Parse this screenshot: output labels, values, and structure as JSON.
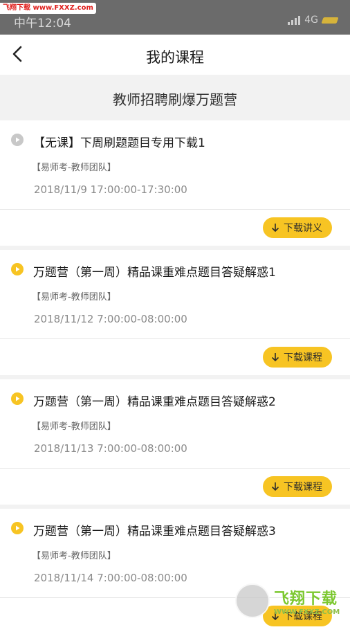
{
  "status_bar": {
    "watermark_badge": "飞翔下载 www.FXXZ.com",
    "time": "中午12:04",
    "network": "4G"
  },
  "nav": {
    "back_icon": "chevron-left-icon",
    "title": "我的课程"
  },
  "section": {
    "title": "教师招聘刷爆万题营"
  },
  "courses": [
    {
      "title": "【无课】下周刷题题目专用下载1",
      "team": "【易师考-教师团队】",
      "time": "2018/11/9 17:00:00-17:30:00",
      "button": "下载讲义",
      "icon_color": "#c8c8c8"
    },
    {
      "title": "万题营（第一周）精品课重难点题目答疑解惑1",
      "team": "【易师考-教师团队】",
      "time": "2018/11/12 7:00:00-08:00:00",
      "button": "下载课程",
      "icon_color": "#f7c423"
    },
    {
      "title": "万题营（第一周）精品课重难点题目答疑解惑2",
      "team": "【易师考-教师团队】",
      "time": "2018/11/13 7:00:00-08:00:00",
      "button": "下载课程",
      "icon_color": "#f7c423"
    },
    {
      "title": "万题营（第一周）精品课重难点题目答疑解惑3",
      "team": "【易师考-教师团队】",
      "time": "2018/11/14 7:00:00-08:00:00",
      "button": "下载课程",
      "icon_color": "#f7c423"
    }
  ],
  "watermark": {
    "cn": "飞翔下载",
    "en": "WWW.FXXZ.COM"
  },
  "colors": {
    "accent": "#f7c423",
    "status_bar": "#6b6b6b",
    "background": "#f2f2f2"
  }
}
